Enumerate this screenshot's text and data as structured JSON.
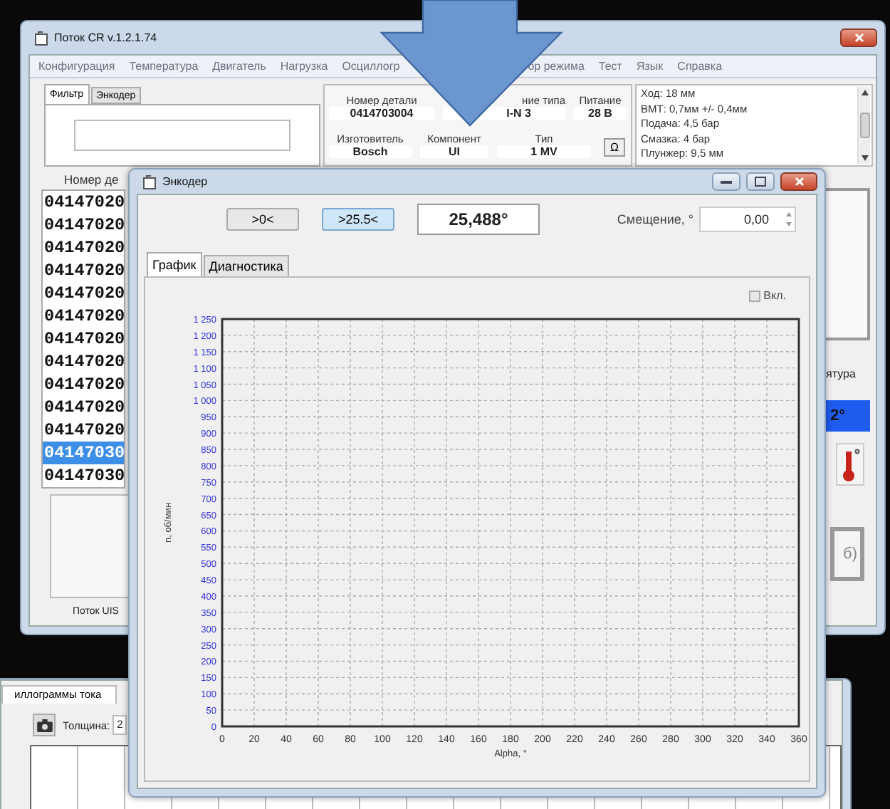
{
  "main_window": {
    "title": "Поток CR v.1.2.1.74",
    "menu": [
      "Конфигурация",
      "Температура",
      "Двигатель",
      "Нагрузка",
      "Осциллогр",
      "ор режима",
      "Тест",
      "Язык",
      "Справка"
    ],
    "filter_tabs": [
      {
        "label": "Фильтр",
        "selected": true
      },
      {
        "label": "Энкодер",
        "selected": false
      }
    ],
    "part_info": {
      "fields": [
        {
          "label": "Номер детали",
          "value": "0414703004"
        },
        {
          "label": "ние типа",
          "value": "I-N 3"
        },
        {
          "label": "Питание",
          "value": "28 В"
        },
        {
          "label": "Изготовитель",
          "value": "Bosch"
        },
        {
          "label": "Компонент",
          "value": "UI"
        },
        {
          "label": "Тип",
          "value": "1 MV"
        }
      ],
      "omega_button": "Ω"
    },
    "notes": [
      "Ход: 18 мм",
      "ВМТ: 0,7мм +/- 0,4мм",
      "Подача: 4,5 бар",
      "Смазка: 4 бар",
      "Плунжер: 9,5 мм"
    ],
    "part_list": {
      "header": "Номер де",
      "rows": [
        {
          "text": "04147020",
          "selected": false
        },
        {
          "text": "04147020",
          "selected": false
        },
        {
          "text": "04147020",
          "selected": false
        },
        {
          "text": "04147020",
          "selected": false
        },
        {
          "text": "04147020",
          "selected": false
        },
        {
          "text": "04147020",
          "selected": false
        },
        {
          "text": "04147020",
          "selected": false
        },
        {
          "text": "04147020",
          "selected": false
        },
        {
          "text": "04147020",
          "selected": false
        },
        {
          "text": "04147020",
          "selected": false
        },
        {
          "text": "04147020",
          "selected": false
        },
        {
          "text": "04147030",
          "selected": true
        },
        {
          "text": "04147030",
          "selected": false
        }
      ]
    },
    "footer": "Поток UIS",
    "side": {
      "label": "ятура",
      "temperature": "2°",
      "button": "б)"
    }
  },
  "encoder_window": {
    "title": "Энкодер",
    "buttons": [
      {
        "label": ">0<",
        "selected": false
      },
      {
        "label": ">25.5<",
        "selected": true
      }
    ],
    "angle": "25,488°",
    "offset_label": "Смещение, °",
    "offset_value": "0,00",
    "tabs": [
      {
        "label": "График",
        "selected": true
      },
      {
        "label": "Диагностика",
        "selected": false
      }
    ],
    "enable": {
      "label": "Вкл.",
      "checked": false
    },
    "chart_data": {
      "type": "line",
      "grid": true,
      "xlabel": "Alpha, °",
      "ylabel": "n, об/мин",
      "xlim": [
        0,
        360
      ],
      "ylim": [
        0,
        1250
      ],
      "xticks": [
        0,
        20,
        40,
        60,
        80,
        100,
        120,
        140,
        160,
        180,
        200,
        220,
        240,
        260,
        280,
        300,
        320,
        340,
        360
      ],
      "yticks": [
        0,
        50,
        100,
        150,
        200,
        250,
        300,
        350,
        400,
        450,
        500,
        550,
        600,
        650,
        700,
        750,
        800,
        850,
        900,
        950,
        {
          "value": 1000,
          "label": "1 000"
        },
        {
          "value": 1050,
          "label": "1 050"
        },
        {
          "value": 1100,
          "label": "1 100"
        },
        {
          "value": 1150,
          "label": "1 150"
        },
        {
          "value": 1200,
          "label": "1 200"
        },
        {
          "value": 1250,
          "label": "1 250"
        }
      ]
    }
  },
  "scope_window": {
    "tab": "иллограммы тока",
    "thickness_label": "Толщина:",
    "thickness_value": "2"
  }
}
